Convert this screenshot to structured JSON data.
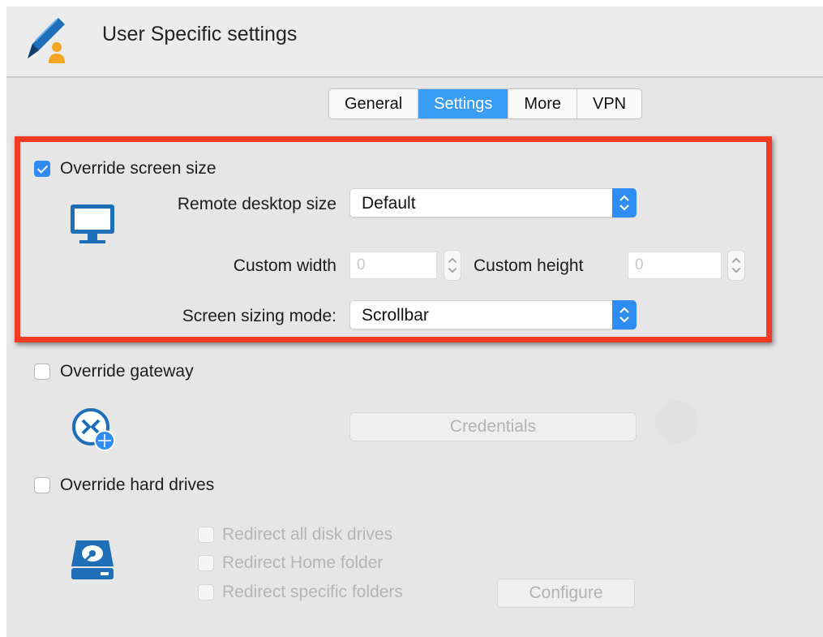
{
  "window": {
    "title": "User Specific settings",
    "app_icon": "pen-user-icon"
  },
  "tabs": [
    {
      "label": "General",
      "active": false
    },
    {
      "label": "Settings",
      "active": true
    },
    {
      "label": "More",
      "active": false
    },
    {
      "label": "VPN",
      "active": false
    }
  ],
  "screen_size": {
    "checkbox_label": "Override screen size",
    "checked": true,
    "icon": "monitor-icon",
    "remote_desktop_size_label": "Remote desktop size",
    "remote_desktop_size_value": "Default",
    "custom_width_label": "Custom width",
    "custom_width_value": "0",
    "custom_height_label": "Custom height",
    "custom_height_value": "0",
    "sizing_mode_label": "Screen sizing mode:",
    "sizing_mode_value": "Scrollbar"
  },
  "gateway": {
    "checkbox_label": "Override gateway",
    "checked": false,
    "icon": "gateway-globe-icon",
    "credentials_label": "Credentials"
  },
  "hard_drives": {
    "checkbox_label": "Override hard drives",
    "checked": false,
    "icon": "hard-drive-icon",
    "options": [
      {
        "label": "Redirect all disk drives"
      },
      {
        "label": "Redirect Home folder"
      },
      {
        "label": "Redirect specific folders"
      }
    ],
    "configure_label": "Configure"
  },
  "colors": {
    "accent": "#2f8cf3",
    "highlight_border": "#ef3b24",
    "icon_blue": "#1f6fb8"
  }
}
